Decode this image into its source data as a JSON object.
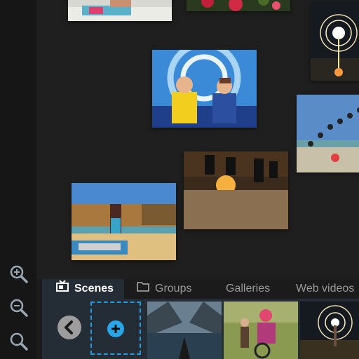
{
  "zoom_controls": {
    "zoom_in": "zoom-in-icon",
    "zoom_out": "zoom-out-icon",
    "zoom_fit": "zoom-icon"
  },
  "canvas": {
    "photos": [
      {
        "subject": "beach-towel-top"
      },
      {
        "subject": "flowers-top"
      },
      {
        "subject": "sparkler-night"
      },
      {
        "subject": "rollercoaster-couple"
      },
      {
        "subject": "jumping-people-beach"
      },
      {
        "subject": "skydivers-sunset"
      },
      {
        "subject": "woman-beach-cliffs"
      }
    ]
  },
  "tabs": [
    {
      "label": "Scenes",
      "icon": "scenes-icon",
      "active": true
    },
    {
      "label": "Groups",
      "icon": "folder-icon",
      "active": false
    },
    {
      "label": "Galleries",
      "active": false
    },
    {
      "label": "Web videos",
      "active": false
    }
  ],
  "strip": {
    "back": "chevron-left-icon",
    "add": "plus-icon",
    "accent": "#1f9be0",
    "thumbnails": [
      "fjord-kayak",
      "girl-bmx",
      "sparkler-tree"
    ]
  }
}
